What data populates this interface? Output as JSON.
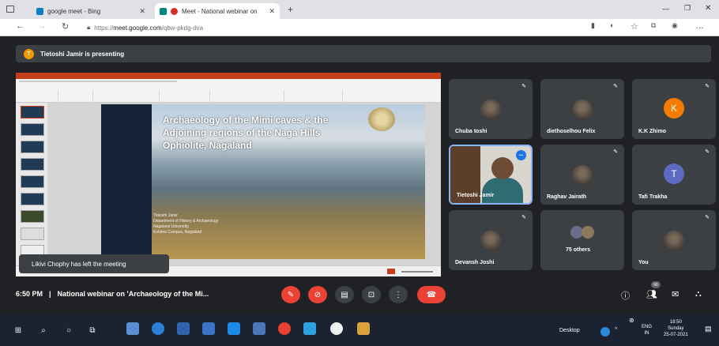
{
  "browser": {
    "tabs": [
      {
        "title": "google meet - Bing"
      },
      {
        "title": "Meet - National webinar on"
      }
    ],
    "url_scheme": "https://",
    "url_host": "meet.google.com",
    "url_path": "/qbw-pkdg-dva"
  },
  "meet": {
    "presenting_text": "Tietoshi Jamir is presenting",
    "presenter_initial": "T",
    "toast": "Likivi Chophy has left the meeting",
    "time": "6:50 PM",
    "meeting_title": "National webinar on 'Archaeology of the Mi...",
    "participant_count_badge": "68",
    "tiles": [
      {
        "name": "Chuba toshi",
        "type": "photo"
      },
      {
        "name": "diethoselhou Felix",
        "type": "photo"
      },
      {
        "name": "K.K Zhimo",
        "type": "letter",
        "letter": "K",
        "color": "#f57c00"
      },
      {
        "name": "Tietoshi Jamir",
        "type": "video"
      },
      {
        "name": "Raghav Jairath",
        "type": "photo"
      },
      {
        "name": "Tafi Trakha",
        "type": "letter",
        "letter": "T",
        "color": "#5c6bc0"
      },
      {
        "name": "Devansh Joshi",
        "type": "photo"
      },
      {
        "name": "75 others",
        "type": "group"
      },
      {
        "name": "You",
        "type": "photo"
      }
    ]
  },
  "slide": {
    "title": "Archaeology of the Mimi caves & the Adjoining regions of the Naga Hills Ophiolite, Nagaland",
    "author": "Tiatoshi Jamir",
    "department": "Department of History & Archaeology",
    "university": "Nagaland University",
    "campus": "Kohima Campus, Nagaland"
  },
  "taskbar": {
    "desktop_label": "Desktop",
    "lang": "ENG",
    "region": "IN",
    "clock": "18:50",
    "day": "Sunday",
    "date": "25-07-2021"
  }
}
